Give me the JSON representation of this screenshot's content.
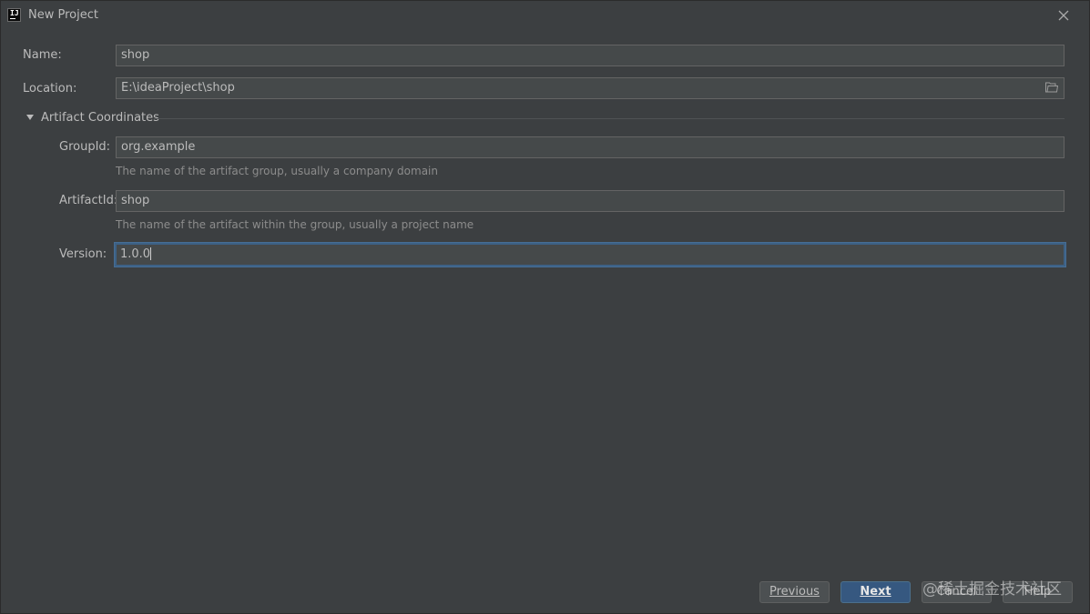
{
  "window": {
    "title": "New Project"
  },
  "form": {
    "name": {
      "label": "Name:",
      "value": "shop"
    },
    "location": {
      "label": "Location:",
      "value": "E:\\ideaProject\\shop"
    },
    "artifact_section": {
      "title": "Artifact Coordinates",
      "expanded": true,
      "group_id": {
        "label": "GroupId:",
        "value": "org.example",
        "hint": "The name of the artifact group, usually a company domain"
      },
      "artifact_id": {
        "label": "ArtifactId:",
        "value": "shop",
        "hint": "The name of the artifact within the group, usually a project name"
      },
      "version": {
        "label": "Version:",
        "value": "1.0.0"
      }
    }
  },
  "buttons": {
    "previous": "Previous",
    "next": "Next",
    "cancel": "Cancel",
    "help": "Help"
  },
  "watermark": "@稀土掘金技术社区",
  "colors": {
    "background": "#3c3f41",
    "field_background": "#45494a",
    "focus_border": "#3d6185",
    "primary_button": "#365880"
  }
}
